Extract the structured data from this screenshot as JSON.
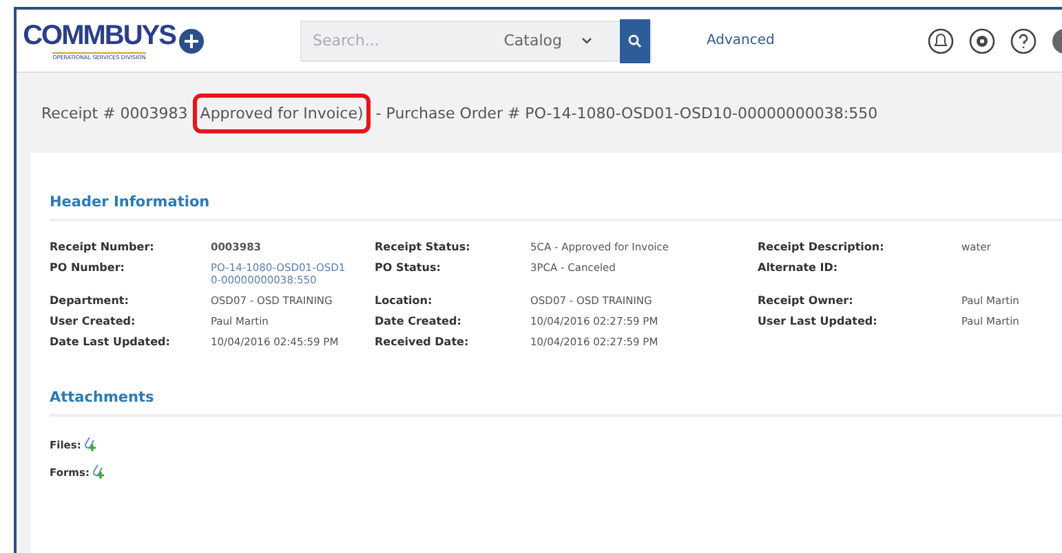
{
  "header": {
    "logo": "COMMBUYS",
    "logo_sub": "OPERATIONAL SERVICES DIVISION",
    "search": {
      "placeholder": "Search..."
    },
    "scope": "Catalog",
    "advanced": "Advanced"
  },
  "title": {
    "prefix": "Receipt # 0003983",
    "highlight": "Approved for Invoice)",
    "suffix": "- Purchase Order # PO-14-1080-OSD01-OSD10-00000000038:550"
  },
  "header_information": {
    "heading": "Header Information",
    "rows": [
      [
        {
          "label": "Receipt Number:",
          "value": "0003983",
          "kind": "bold"
        },
        {
          "label": "Receipt Status:",
          "value": "5CA - Approved for Invoice",
          "kind": "text"
        },
        {
          "label": "Receipt Description:",
          "value": "water",
          "kind": "text"
        }
      ],
      [
        {
          "label": "PO Number:",
          "value": "PO-14-1080-OSD01-OSD10-00000000038:550",
          "kind": "link"
        },
        {
          "label": "PO Status:",
          "value": "3PCA - Canceled",
          "kind": "text"
        },
        {
          "label": "Alternate ID:"
        }
      ],
      [
        {
          "label": "Department:",
          "value": "OSD07 - OSD TRAINING",
          "kind": "text"
        },
        {
          "label": "Location:",
          "value": "OSD07 - OSD TRAINING",
          "kind": "text"
        },
        {
          "label": "Receipt Owner:",
          "value": "Paul Martin",
          "kind": "text"
        }
      ],
      [
        {
          "label": "User Created:",
          "value": "Paul Martin",
          "kind": "text"
        },
        {
          "label": "Date Created:",
          "value": "10/04/2016 02:27:59 PM",
          "kind": "text"
        },
        {
          "label": "User Last Updated:",
          "value": "Paul Martin",
          "kind": "text"
        }
      ],
      [
        {
          "label": "Date Last Updated:",
          "value": "10/04/2016 02:45:59 PM",
          "kind": "text"
        },
        {
          "label": "Received Date:",
          "value": "10/04/2016 02:27:59 PM",
          "kind": "text"
        }
      ]
    ]
  },
  "attachments": {
    "heading": "Attachments",
    "items": [
      "Files:",
      "Forms:"
    ]
  }
}
